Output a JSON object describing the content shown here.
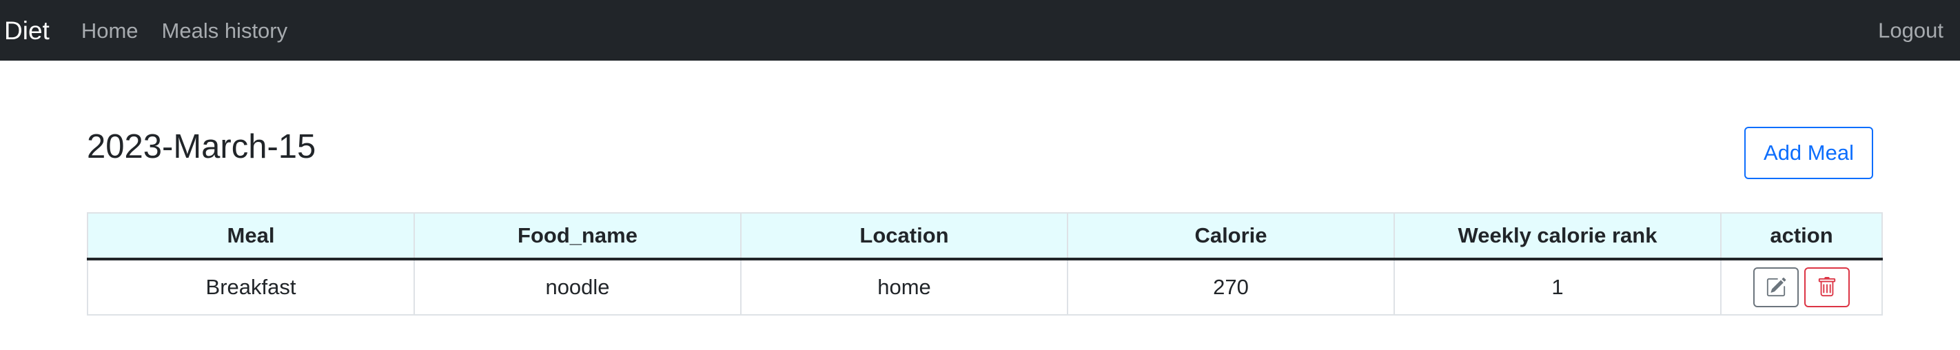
{
  "nav": {
    "brand": "Diet",
    "links": [
      "Home",
      "Meals history"
    ],
    "logout": "Logout"
  },
  "page": {
    "title": "2023-March-15",
    "add_meal_label": "Add Meal"
  },
  "table": {
    "headers": [
      "Meal",
      "Food_name",
      "Location",
      "Calorie",
      "Weekly calorie rank",
      "action"
    ],
    "rows": [
      [
        "Breakfast",
        "noodle",
        "home",
        "270",
        "1"
      ]
    ]
  },
  "colors": {
    "navbar_bg": "#212529",
    "header_bg": "#e4fcfe",
    "primary": "#0d6efd",
    "danger": "#dc3545",
    "secondary": "#6c757d"
  },
  "icons": {
    "edit": "pencil-square-icon",
    "delete": "trash-icon"
  }
}
